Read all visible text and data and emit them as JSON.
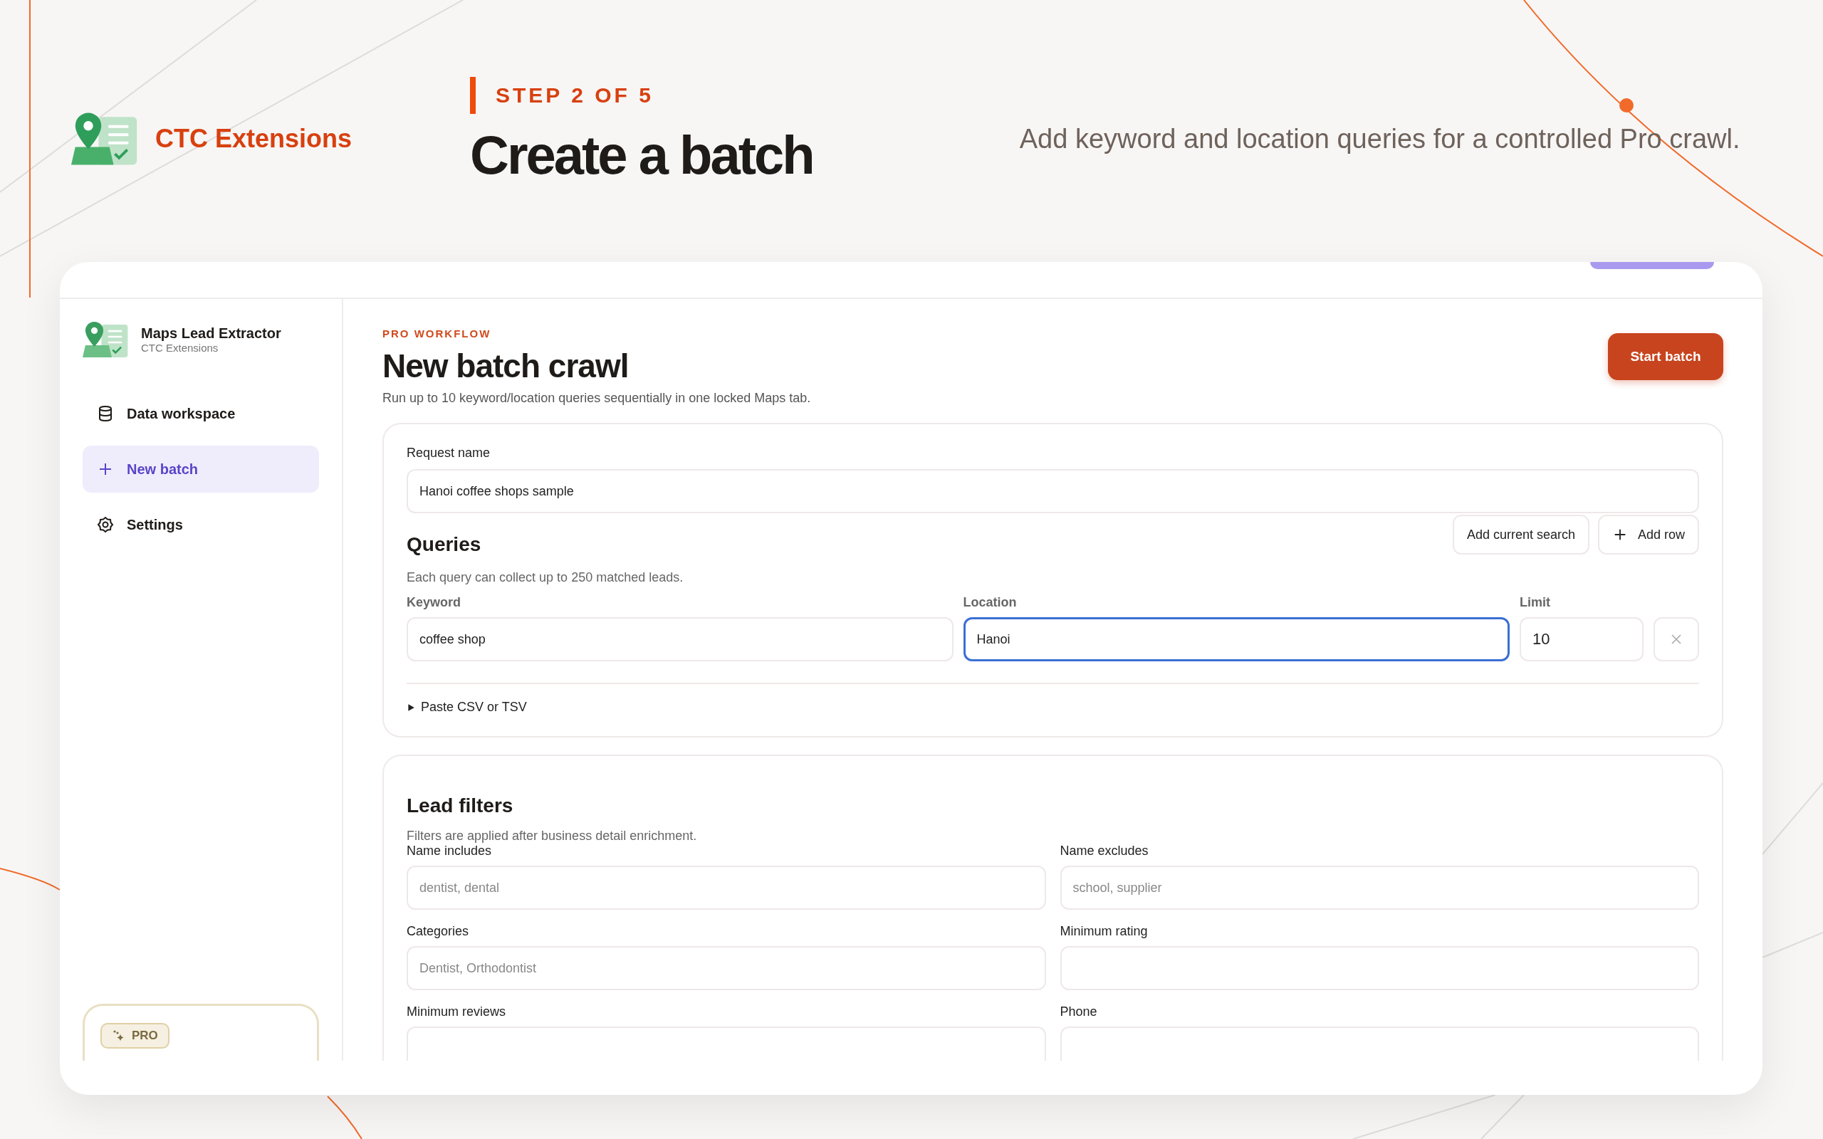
{
  "brand": {
    "name": "CTC Extensions"
  },
  "step": {
    "label": "STEP 2 OF 5",
    "title": "Create a batch",
    "tagline": "Add keyword and location queries for a controlled Pro crawl."
  },
  "app": {
    "sidebar": {
      "title": "Maps Lead Extractor",
      "subtitle": "CTC Extensions",
      "items": [
        {
          "label": "Data workspace",
          "kind": "database",
          "selected": false
        },
        {
          "label": "New batch",
          "kind": "add",
          "selected": true
        },
        {
          "label": "Settings",
          "kind": "settings",
          "selected": false
        }
      ],
      "plan_badge": "PRO"
    },
    "header": {
      "eyebrow": "PRO WORKFLOW",
      "title": "New batch crawl",
      "subtitle": "Run up to 10 keyword/location queries sequentially in one locked Maps tab.",
      "primary_button": "Start batch"
    },
    "request": {
      "label": "Request name",
      "value": "Hanoi coffee shops sample"
    },
    "queries": {
      "title": "Queries",
      "buttons": [
        {
          "label": "Add current search",
          "kind": "plain"
        },
        {
          "label": "Add row",
          "kind": "add"
        }
      ],
      "help": "Each query can collect up to 250 matched leads.",
      "columns": [
        "Keyword",
        "Location",
        "Limit"
      ],
      "rows": [
        {
          "keyword": "coffee shop",
          "location": "Hanoi",
          "limit": "10",
          "location_focused": true
        }
      ],
      "paste_toggle": {
        "label": "Paste CSV or TSV",
        "expanded": false
      }
    },
    "filters": {
      "title": "Lead filters",
      "help": "Filters are applied after business detail enrichment.",
      "fields": [
        {
          "label": "Name includes",
          "placeholder": "dentist, dental"
        },
        {
          "label": "Name excludes",
          "placeholder": "school, supplier"
        },
        {
          "label": "Categories",
          "placeholder": "Dentist, Orthodontist"
        },
        {
          "label": "Minimum rating"
        },
        {
          "label": "Minimum reviews"
        },
        {
          "label": "Phone"
        }
      ]
    }
  }
}
